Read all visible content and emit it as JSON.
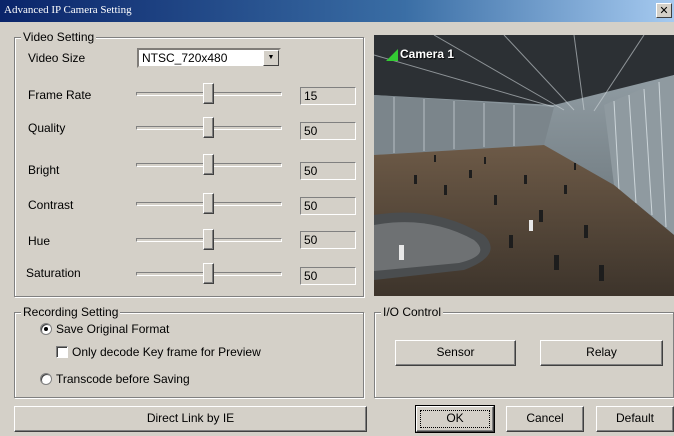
{
  "window": {
    "title": "Advanced IP Camera Setting",
    "close_glyph": "✕"
  },
  "video_setting": {
    "legend": "Video Setting",
    "video_size_label": "Video Size",
    "video_size_value": "NTSC_720x480",
    "sliders": [
      {
        "label": "Frame Rate",
        "value": "15"
      },
      {
        "label": "Quality",
        "value": "50"
      },
      {
        "label": "Bright",
        "value": "50"
      },
      {
        "label": "Contrast",
        "value": "50"
      },
      {
        "label": "Hue",
        "value": "50"
      },
      {
        "label": "Saturation",
        "value": "50"
      }
    ]
  },
  "preview": {
    "camera_label": "Camera 1",
    "indicator_color": "#33cc33"
  },
  "recording_setting": {
    "legend": "Recording Setting",
    "save_original": "Save Original Format",
    "only_decode_key": "Only decode Key frame for Preview",
    "transcode": "Transcode before Saving",
    "save_original_checked": true,
    "only_decode_key_checked": false
  },
  "io_control": {
    "legend": "I/O Control",
    "sensor_label": "Sensor",
    "relay_label": "Relay"
  },
  "footer": {
    "direct_link_label": "Direct Link by IE",
    "ok_label": "OK",
    "cancel_label": "Cancel",
    "default_label": "Default"
  }
}
